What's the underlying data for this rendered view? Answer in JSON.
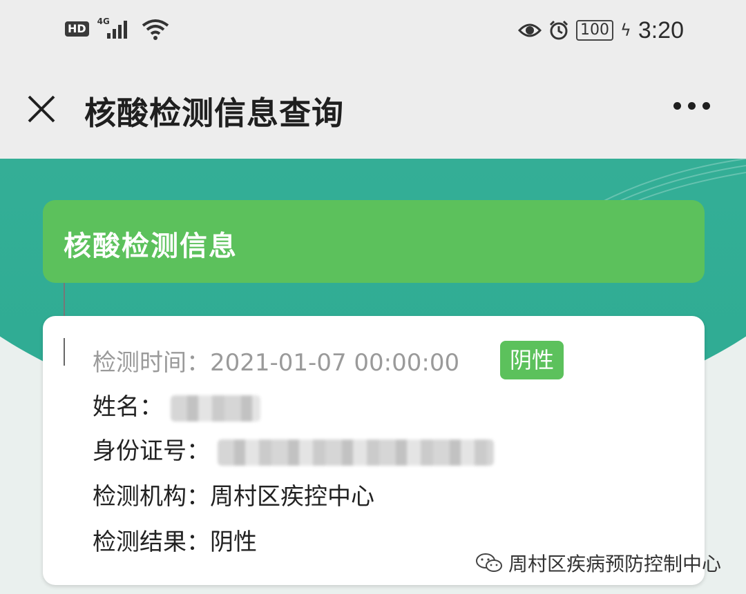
{
  "status_bar": {
    "hd": "HD",
    "network": "4G",
    "battery": "100",
    "time": "3:20"
  },
  "nav": {
    "title": "核酸检测信息查询"
  },
  "section": {
    "header": "核酸检测信息"
  },
  "record": {
    "test_time_label": "检测时间：",
    "test_time_value": "2021-01-07 00:00:00",
    "result_badge": "阴性",
    "name_label": "姓名：",
    "id_label": "身份证号：",
    "org_label": "检测机构：",
    "org_value": "周村区疾控中心",
    "result_label": "检测结果：",
    "result_value": "阴性"
  },
  "watermark": {
    "text": "周村区疾病预防控制中心"
  },
  "colors": {
    "teal": "#2eab93",
    "green": "#5cc15c"
  }
}
